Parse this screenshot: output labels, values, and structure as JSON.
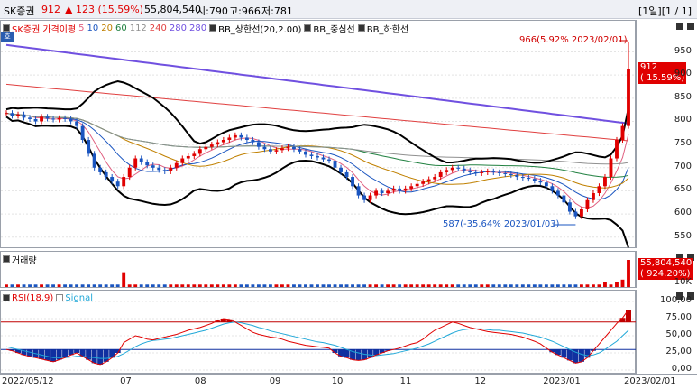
{
  "header": {
    "name": "SK증권",
    "price": "912",
    "change": "▲ 123 (15.59%)",
    "volume": "55,804,540",
    "open": "시:790",
    "high": "고:966",
    "low": "저:781",
    "period": "[1일][1 / 1]"
  },
  "price_pane": {
    "badge": "호",
    "legend": [
      {
        "label": "SK증권",
        "color": "#e00000"
      },
      {
        "label": "가격이평",
        "color": "#e00000"
      },
      {
        "label": "5",
        "color": "#e06080"
      },
      {
        "label": "10",
        "color": "#1a55c0"
      },
      {
        "label": "20",
        "color": "#c08000"
      },
      {
        "label": "60",
        "color": "#208040"
      },
      {
        "label": "112",
        "color": "#909090"
      },
      {
        "label": "240",
        "color": "#e04040"
      },
      {
        "label": "280",
        "color": "#7050e0"
      },
      {
        "label": "280",
        "color": "#7050e0"
      },
      {
        "label": "BB_상한선(20,2.00)",
        "color": "#000000"
      },
      {
        "label": "BB_중심선",
        "color": "#000000"
      },
      {
        "label": "BB_하한선",
        "color": "#000000"
      }
    ],
    "yticks": [
      "950",
      "900",
      "850",
      "800",
      "750",
      "700",
      "650",
      "600",
      "550"
    ],
    "last_tag": "912\n( 15.59%)",
    "high_annot": "966(5.92% 2023/02/01)",
    "low_annot": "587(-35.64% 2023/01/03)"
  },
  "vol_pane": {
    "legend": "거래량",
    "tag": "55,804,540\n( 924.20%)",
    "ytick": "10K"
  },
  "rsi_pane": {
    "legend_rsi": "RSI(18,9)",
    "legend_signal": "Signal",
    "yticks": [
      "100,00",
      "75,00",
      "50,00",
      "25,00",
      "0,00"
    ],
    "colors": {
      "rsi": "#e00000",
      "signal": "#20a8d8",
      "over": "#c00000",
      "under": "#1030a0"
    }
  },
  "xaxis": {
    "ticks": [
      "2022/05/12",
      "07",
      "08",
      "09",
      "10",
      "11",
      "12",
      "2023/01",
      "2023/02/01"
    ]
  },
  "chart_data": {
    "type": "candlestick",
    "x_start": "2022/05/12",
    "x_end": "2023/02/01",
    "ylim": [
      530,
      990
    ],
    "close_series": [
      818,
      812,
      815,
      808,
      805,
      800,
      810,
      806,
      804,
      807,
      805,
      800,
      790,
      760,
      730,
      700,
      690,
      680,
      670,
      660,
      680,
      700,
      720,
      712,
      705,
      700,
      695,
      692,
      700,
      710,
      720,
      725,
      730,
      740,
      745,
      750,
      755,
      760,
      765,
      770,
      765,
      760,
      755,
      745,
      740,
      735,
      738,
      742,
      745,
      740,
      735,
      728,
      725,
      722,
      718,
      715,
      700,
      690,
      680,
      660,
      640,
      630,
      640,
      650,
      645,
      650,
      655,
      650,
      655,
      660,
      665,
      670,
      675,
      680,
      690,
      695,
      700,
      698,
      694,
      690,
      688,
      690,
      692,
      690,
      688,
      686,
      684,
      680,
      678,
      676,
      672,
      668,
      660,
      650,
      640,
      625,
      605,
      595,
      610,
      630,
      645,
      660,
      680,
      720,
      760,
      790,
      912
    ],
    "vol_series": [
      1,
      1,
      1,
      1,
      1,
      1,
      1,
      1,
      1,
      1,
      1,
      1,
      1,
      1,
      1,
      1,
      1,
      1,
      1,
      1,
      6,
      1,
      1,
      1,
      1,
      1,
      1,
      1,
      1,
      1,
      1,
      1,
      1,
      1,
      1,
      1,
      1,
      1,
      1,
      1,
      1,
      1,
      1,
      1,
      1,
      1,
      1,
      1,
      1,
      1,
      1,
      1,
      1,
      1,
      1,
      1,
      1,
      1,
      1,
      1,
      1,
      1,
      1,
      1,
      1,
      1,
      1,
      1,
      1,
      1,
      1,
      1,
      1,
      1,
      1,
      1,
      1,
      1,
      1,
      1,
      1,
      1,
      1,
      1,
      1,
      1,
      1,
      1,
      1,
      1,
      1,
      1,
      1,
      1,
      1,
      1,
      1,
      1,
      1,
      1,
      1,
      1,
      2,
      1,
      2,
      3,
      11
    ],
    "rsi_series": [
      30,
      28,
      25,
      22,
      20,
      18,
      16,
      14,
      12,
      15,
      18,
      22,
      25,
      20,
      15,
      10,
      8,
      12,
      18,
      25,
      40,
      45,
      50,
      48,
      45,
      44,
      46,
      48,
      50,
      52,
      55,
      58,
      60,
      62,
      65,
      68,
      72,
      75,
      74,
      70,
      65,
      60,
      55,
      52,
      50,
      48,
      47,
      45,
      42,
      40,
      38,
      36,
      35,
      34,
      33,
      32,
      25,
      20,
      18,
      15,
      14,
      15,
      18,
      22,
      25,
      28,
      30,
      32,
      35,
      38,
      40,
      45,
      52,
      58,
      62,
      66,
      70,
      68,
      65,
      62,
      60,
      58,
      56,
      55,
      54,
      53,
      52,
      50,
      48,
      45,
      42,
      38,
      32,
      26,
      22,
      18,
      14,
      10,
      12,
      18,
      28,
      38,
      48,
      58,
      68,
      76,
      88
    ],
    "signal_series": [
      34,
      32,
      30,
      28,
      26,
      24,
      22,
      20,
      18,
      18,
      18,
      19,
      20,
      20,
      19,
      18,
      17,
      17,
      18,
      20,
      24,
      29,
      34,
      38,
      41,
      43,
      44,
      45,
      46,
      48,
      50,
      52,
      54,
      56,
      58,
      61,
      64,
      67,
      69,
      70,
      69,
      67,
      65,
      62,
      60,
      57,
      55,
      53,
      51,
      49,
      47,
      45,
      43,
      41,
      40,
      38,
      36,
      33,
      30,
      27,
      25,
      23,
      22,
      21,
      22,
      23,
      24,
      26,
      28,
      30,
      32,
      35,
      38,
      42,
      46,
      50,
      54,
      57,
      59,
      60,
      60,
      60,
      59,
      58,
      58,
      57,
      56,
      55,
      54,
      52,
      50,
      48,
      45,
      42,
      38,
      34,
      30,
      26,
      23,
      21,
      22,
      25,
      30,
      36,
      42,
      50,
      58
    ],
    "rsi_levels": [
      70,
      30
    ],
    "high": {
      "value": 966,
      "date": "2023/02/01"
    },
    "low": {
      "value": 587,
      "date": "2023/01/03"
    }
  }
}
